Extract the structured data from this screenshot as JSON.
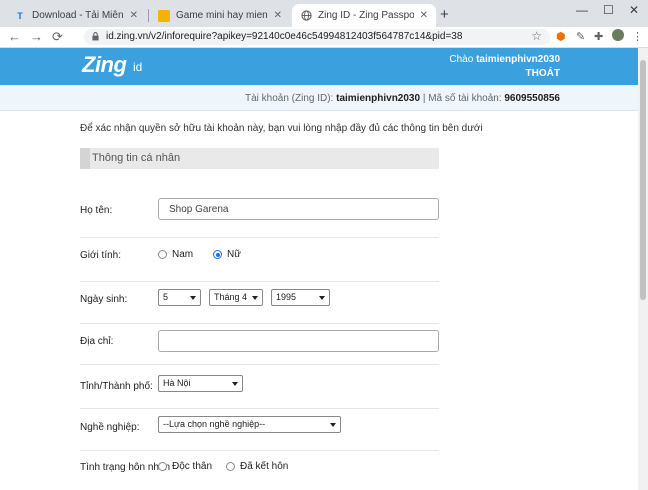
{
  "browser": {
    "tabs": [
      {
        "title": "Download - Tải Miễn Phí VN - Ph",
        "favicon": "T"
      },
      {
        "title": "Game mini hay mien phi - Choi g",
        "favicon": "game-icon"
      },
      {
        "title": "Zing ID - Zing Passport - Tài khoả",
        "favicon": "globe-icon"
      }
    ],
    "url": "id.zing.vn/v2/inforequire?apikey=92140c0e46c54994812403f564787c14&pid=38"
  },
  "header": {
    "logo_text": "Zing",
    "logo_suffix": "id",
    "greeting_prefix": "Chào",
    "username": "taimienphivn2030",
    "logout": "THOÁT"
  },
  "account_bar": {
    "account_label": "Tài khoản (Zing ID):",
    "account_value": "taimienphivn2030",
    "separator": "|",
    "id_label": "Mã số tài khoản:",
    "id_value": "9609550856"
  },
  "form": {
    "intro": "Để xác nhận quyền sở hữu tài khoản này, bạn vui lòng nhập đầy đủ các thông tin bên dưới",
    "section_title": "Thông tin cá nhân",
    "fullname": {
      "label": "Họ tên:",
      "value": "Shop Garena"
    },
    "gender": {
      "label": "Giới tính:",
      "male": "Nam",
      "female": "Nữ",
      "selected": "female"
    },
    "birthday": {
      "label": "Ngày sinh:",
      "day": "5",
      "month": "Tháng 4",
      "year": "1995"
    },
    "address": {
      "label": "Địa chỉ:",
      "value": ""
    },
    "city": {
      "label": "Tỉnh/Thành phố:",
      "value": "Hà Nội"
    },
    "job": {
      "label": "Nghề nghiệp:",
      "value": "--Lựa chọn nghề nghiệp--"
    },
    "marital": {
      "label": "Tình trạng hôn nhân",
      "single": "Độc thân",
      "married": "Đã kết hôn"
    }
  }
}
